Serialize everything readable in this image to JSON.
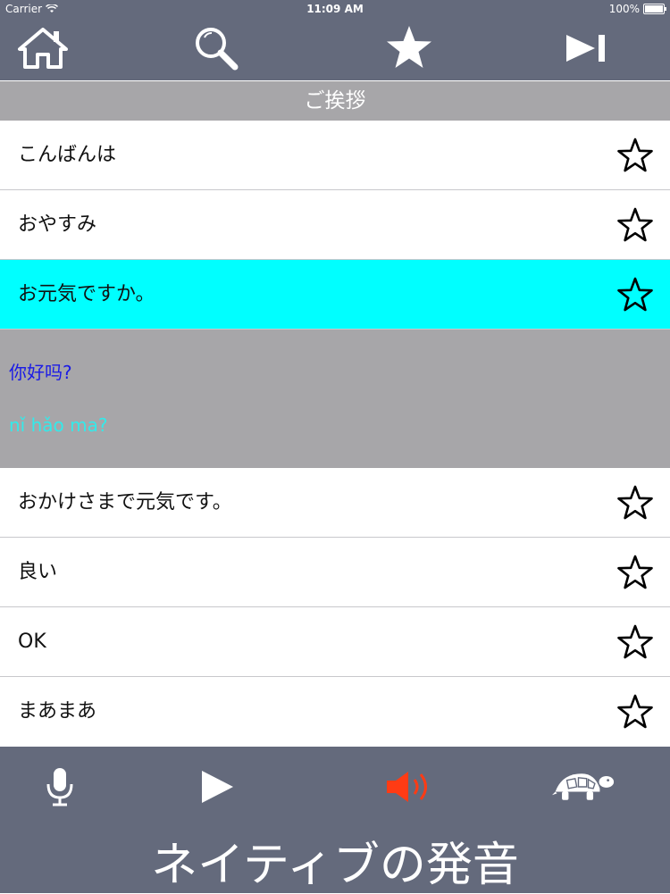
{
  "status": {
    "carrier": "Carrier",
    "time": "11:09 AM",
    "battery": "100%"
  },
  "toolbar": {
    "home": "home-icon",
    "search": "search-icon",
    "favorite": "star-icon",
    "next": "skip-next-icon"
  },
  "section": {
    "title": "ご挨拶"
  },
  "rows": [
    {
      "label": "こんばんは"
    },
    {
      "label": "おやすみ"
    },
    {
      "label": "お元気ですか。"
    }
  ],
  "detail": {
    "chinese": "你好吗?",
    "pinyin": "nǐ hǎo ma?"
  },
  "rows2": [
    {
      "label": "おかけさまで元気です。"
    },
    {
      "label": "良い"
    },
    {
      "label": "OK"
    },
    {
      "label": "まあまあ"
    }
  ],
  "bottom": {
    "mic": "microphone-icon",
    "play": "play-icon",
    "speaker": "speaker-icon",
    "turtle": "turtle-icon",
    "native_label": "ネイティブの発音"
  },
  "colors": {
    "bar": "#646a7c",
    "section": "#a7a6a9",
    "selected": "#00ffff",
    "speaker": "#ff3b14",
    "chinese": "#1a1ae6",
    "pinyin": "#33eaea"
  }
}
